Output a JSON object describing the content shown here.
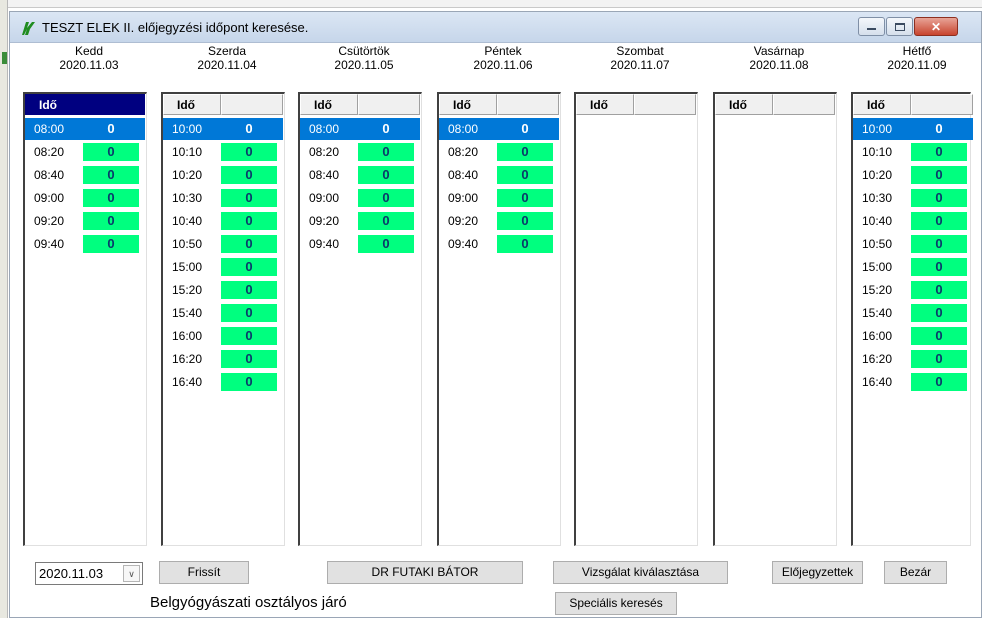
{
  "window": {
    "title": "TESZT ELEK II. előjegyzési időpont keresése.",
    "buttons": {
      "minimize": "minimize",
      "maximize": "maximize",
      "close": "✕"
    }
  },
  "columns": [
    {
      "day": "Kedd",
      "date": "2020.11.03",
      "header": "Idő",
      "active": true,
      "slots": [
        {
          "time": "08:00",
          "count": "0",
          "selected": true
        },
        {
          "time": "08:20",
          "count": "0"
        },
        {
          "time": "08:40",
          "count": "0"
        },
        {
          "time": "09:00",
          "count": "0"
        },
        {
          "time": "09:20",
          "count": "0"
        },
        {
          "time": "09:40",
          "count": "0"
        }
      ]
    },
    {
      "day": "Szerda",
      "date": "2020.11.04",
      "header": "Idő",
      "slots": [
        {
          "time": "10:00",
          "count": "0",
          "selected": true
        },
        {
          "time": "10:10",
          "count": "0"
        },
        {
          "time": "10:20",
          "count": "0"
        },
        {
          "time": "10:30",
          "count": "0"
        },
        {
          "time": "10:40",
          "count": "0"
        },
        {
          "time": "10:50",
          "count": "0"
        },
        {
          "time": "15:00",
          "count": "0"
        },
        {
          "time": "15:20",
          "count": "0"
        },
        {
          "time": "15:40",
          "count": "0"
        },
        {
          "time": "16:00",
          "count": "0"
        },
        {
          "time": "16:20",
          "count": "0"
        },
        {
          "time": "16:40",
          "count": "0"
        }
      ]
    },
    {
      "day": "Csütörtök",
      "date": "2020.11.05",
      "header": "Idő",
      "slots": [
        {
          "time": "08:00",
          "count": "0",
          "selected": true
        },
        {
          "time": "08:20",
          "count": "0"
        },
        {
          "time": "08:40",
          "count": "0"
        },
        {
          "time": "09:00",
          "count": "0"
        },
        {
          "time": "09:20",
          "count": "0"
        },
        {
          "time": "09:40",
          "count": "0"
        }
      ]
    },
    {
      "day": "Péntek",
      "date": "2020.11.06",
      "header": "Idő",
      "slots": [
        {
          "time": "08:00",
          "count": "0",
          "selected": true
        },
        {
          "time": "08:20",
          "count": "0"
        },
        {
          "time": "08:40",
          "count": "0"
        },
        {
          "time": "09:00",
          "count": "0"
        },
        {
          "time": "09:20",
          "count": "0"
        },
        {
          "time": "09:40",
          "count": "0"
        }
      ]
    },
    {
      "day": "Szombat",
      "date": "2020.11.07",
      "header": "Idő",
      "slots": []
    },
    {
      "day": "Vasárnap",
      "date": "2020.11.08",
      "header": "Idő",
      "slots": []
    },
    {
      "day": "Hétfő",
      "date": "2020.11.09",
      "header": "Idő",
      "slots": [
        {
          "time": "10:00",
          "count": "0",
          "selected": true
        },
        {
          "time": "10:10",
          "count": "0"
        },
        {
          "time": "10:20",
          "count": "0"
        },
        {
          "time": "10:30",
          "count": "0"
        },
        {
          "time": "10:40",
          "count": "0"
        },
        {
          "time": "10:50",
          "count": "0"
        },
        {
          "time": "15:00",
          "count": "0"
        },
        {
          "time": "15:20",
          "count": "0"
        },
        {
          "time": "15:40",
          "count": "0"
        },
        {
          "time": "16:00",
          "count": "0"
        },
        {
          "time": "16:20",
          "count": "0"
        },
        {
          "time": "16:40",
          "count": "0"
        }
      ]
    }
  ],
  "bottom": {
    "date_value": "2020.11.03",
    "refresh": "Frissít",
    "doctor": "DR FUTAKI BÁTOR",
    "exam_select": "Vizsgálat kiválasztása",
    "appointments": "Előjegyzettek",
    "close": "Bezár",
    "department": "Belgyógyászati osztályos járó",
    "special_search": "Speciális keresés"
  },
  "colors": {
    "slot_count_bg": "#00ff7f",
    "selected_row": "#0078d7",
    "active_header": "#000080"
  }
}
